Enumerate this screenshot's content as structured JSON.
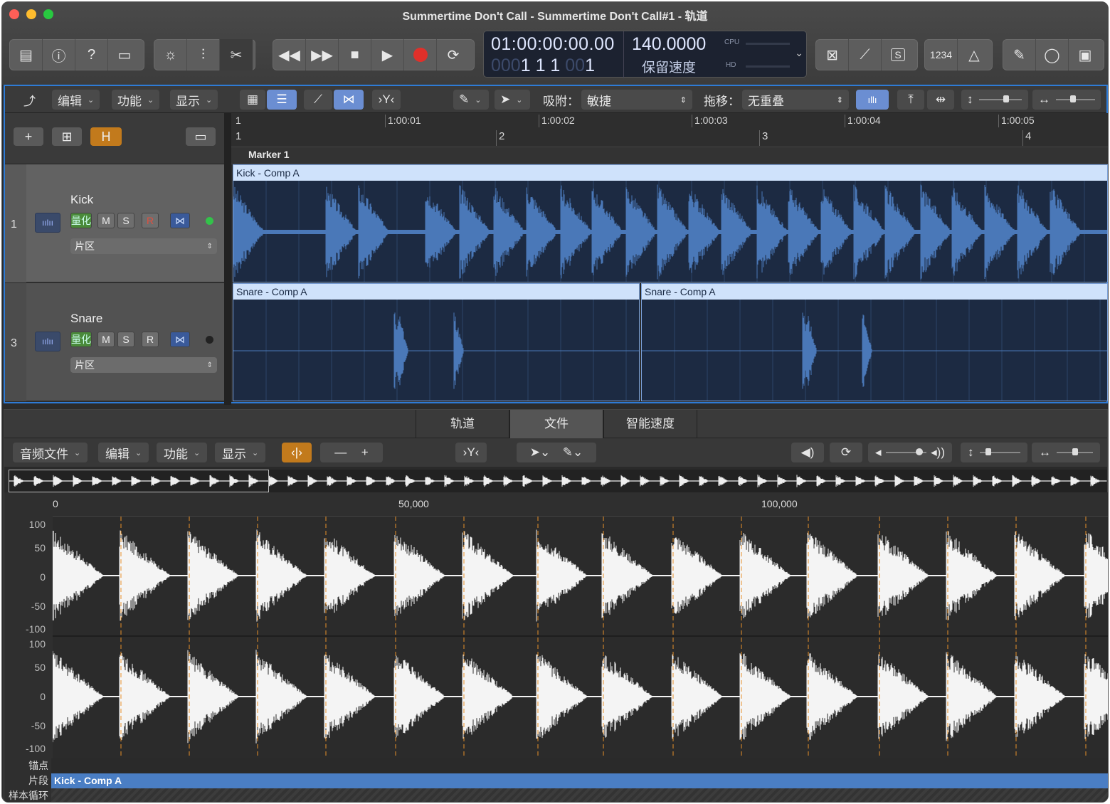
{
  "window": {
    "title": "Summertime Don't Call - Summertime Don't Call#1 - 轨道",
    "traffic_lights": {
      "close": "#fe5f57",
      "minimize": "#febc2e",
      "zoom": "#28c840"
    }
  },
  "control_bar": {
    "left_icons": [
      "library-icon",
      "info-icon",
      "help-icon",
      "toolbar-icon"
    ],
    "edit_icons": [
      "smart-controls-icon",
      "mixer-icon",
      "editor-scissors-icon"
    ],
    "transport_icons": [
      "rewind-icon",
      "fast-forward-icon",
      "stop-icon",
      "play-icon",
      "record-icon",
      "cycle-icon"
    ],
    "right_icons": [
      "replace-icon",
      "tuner-icon",
      "solo-icon",
      "count-in-icon",
      "metronome-icon",
      "notepad-icon",
      "loop-browser-icon",
      "browser-icon"
    ],
    "count_in_label": "1234",
    "solo_label": "S",
    "lcd": {
      "time": "01:00:00:00.00",
      "bars_dim": "000",
      "bars": "1 1 1",
      "beat_dim": "00",
      "beat": "1",
      "tempo": "140.0000",
      "tempo_mode": "保留速度",
      "cpu_label": "CPU",
      "hd_label": "HD"
    }
  },
  "tracks_toolbar": {
    "edit": "编辑",
    "functions": "功能",
    "view": "显示",
    "snap_label": "吸附：",
    "snap_value": "敏捷",
    "drag_label": "拖移：",
    "drag_value": "无重叠"
  },
  "track_header_buttons": {
    "add": "+",
    "duplicate": "+",
    "hide": "H"
  },
  "ruler": {
    "timecode": [
      "1",
      "1:00:01",
      "1:00:02",
      "1:00:03",
      "1:00:04",
      "1:00:05"
    ],
    "bars": [
      "1",
      "2",
      "3",
      "4"
    ]
  },
  "marker": "Marker 1",
  "tracks": [
    {
      "number": "1",
      "name": "Kick",
      "quantize": "量化",
      "mute": "M",
      "solo": "S",
      "record": "R",
      "region_menu": "片区",
      "status_color": "#33c24a",
      "region": "Kick - Comp A"
    },
    {
      "number": "3",
      "name": "Snare",
      "quantize": "量化",
      "mute": "M",
      "solo": "S",
      "record": "R",
      "region_menu": "片区",
      "status_color": "#222222",
      "regions": [
        "Snare - Comp A",
        "Snare - Comp A"
      ]
    }
  ],
  "editor": {
    "tabs": [
      "轨道",
      "文件",
      "智能速度"
    ],
    "active_tab": "文件",
    "menus": [
      "音频文件",
      "编辑",
      "功能",
      "显示"
    ],
    "ruler": [
      "0",
      "50,000",
      "100,000"
    ],
    "y_axis": [
      "100",
      "50",
      "0",
      "-50",
      "-100",
      "100",
      "50",
      "0",
      "-50",
      "-100"
    ],
    "lanes": {
      "anchor": "锚点",
      "region_label": "片段",
      "region_name": "Kick - Comp A",
      "loop": "样本循环"
    }
  }
}
